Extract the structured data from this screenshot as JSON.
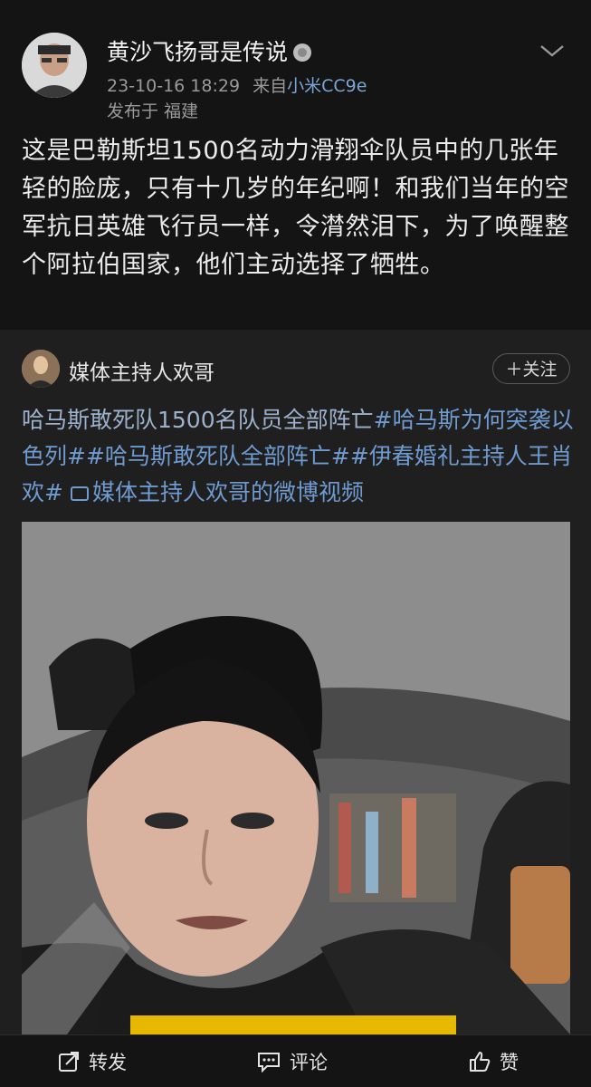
{
  "post": {
    "username": "黄沙飞扬哥是传说",
    "datetime": "23-10-16 18:29",
    "source_prefix": "来自",
    "device": "小米CC9e",
    "location": "发布于 福建",
    "text": "这是巴勒斯坦1500名动力滑翔伞队员中的几张年轻的脸庞，只有十几岁的年纪啊！和我们当年的空军抗日英雄飞行员一样，令潸然泪下，为了唤醒整个阿拉伯国家，他们主动选择了牺牲。"
  },
  "repost": {
    "username": "媒体主持人欢哥",
    "follow_label": "＋关注",
    "text_plain": "哈马斯敢死队1500名队员全部阵亡",
    "tag1": "#哈马斯为何突袭以色列#",
    "tag2": "#哈马斯敢死队全部阵亡#",
    "tag3": "#伊春婚礼主持人王肖欢#",
    "video_link": "媒体主持人欢哥的微博视频"
  },
  "actions": {
    "repost_label": "转发",
    "comment_label": "评论",
    "like_label": "赞"
  }
}
